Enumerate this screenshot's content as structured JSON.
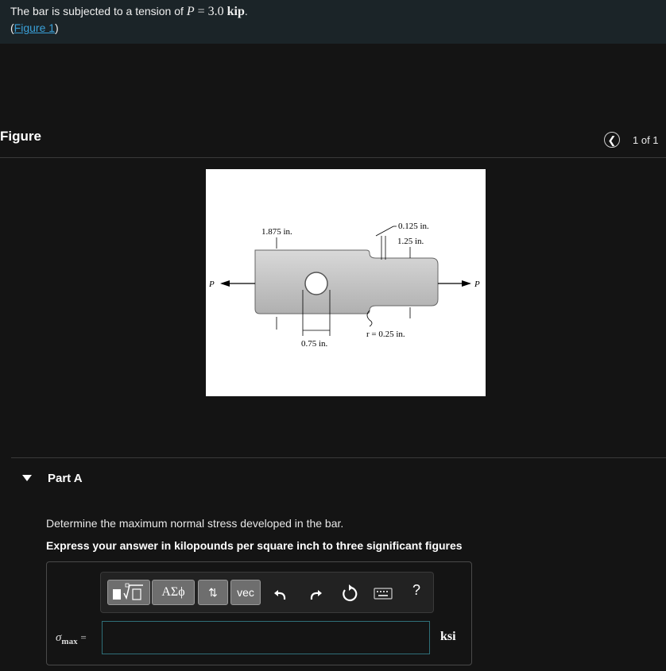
{
  "problem": {
    "text_before": "The bar is subjected to a tension of ",
    "var": "P",
    "eq": " = 3.0 ",
    "unit": "kip",
    "period": ".",
    "link_open": "(",
    "link_text": "Figure 1",
    "link_close": ")"
  },
  "figure": {
    "heading": "Figure",
    "pager": "1 of 1",
    "labels": {
      "p_left": "P",
      "p_right": "P",
      "dim_1875": "1.875 in.",
      "dim_0125": "0.125 in.",
      "dim_125": "1.25 in.",
      "dim_075": "0.75 in.",
      "radius": "r = 0.25 in."
    }
  },
  "partA": {
    "title": "Part A",
    "question": "Determine the maximum normal stress developed in the bar.",
    "instruction": "Express your answer in kilopounds per square inch to three significant figures",
    "toolbar": {
      "greek": "ΑΣϕ",
      "updown": "⇅",
      "vec": "vec",
      "help": "?"
    },
    "answer": {
      "symbol": "σ",
      "subscript": "max",
      "equals": "=",
      "value": "",
      "unit": "ksi"
    }
  }
}
